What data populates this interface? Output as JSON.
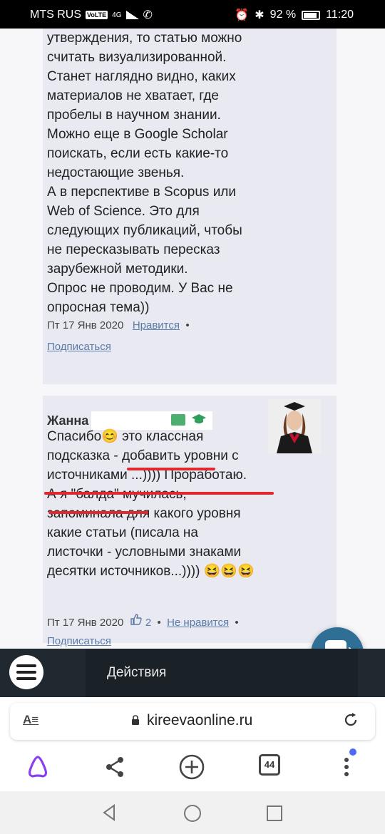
{
  "status_bar": {
    "carrier": "MTS RUS",
    "volte": "VoLTE",
    "network": "4G",
    "battery": "92 %",
    "time": "11:20"
  },
  "comment1": {
    "text": "утверждения, то статью можно\nсчитать визуализированной.\nСтанет наглядно видно, каких\nматериалов не хватает, где\nпробелы в научном знании.\nМожно еще в Google Scholar\nпоискать, если есть какие-то\nнедостающие звенья.\nА в перспективе в Scopus или\nWeb of Science. Это для\nследующих публикаций, чтобы\nне пересказывать пересказ\nзарубежной методики.\nОпрос не проводим. У Вас не\nопросная тема))",
    "date": "Пт 17 Янв 2020",
    "like_label": "Нравится",
    "subscribe_label": "Подписаться"
  },
  "comment2": {
    "author": "Жанна",
    "text_prefix": "Спасибо",
    "text": "это классная\nподсказка - добавить уровни с\nисточниками ...)))) Проработаю.\nА я \"балда\" мучилась,\nзапоминала для какого уровня\nкакие статьи (писала на\nлисточки - условными знаками\nдесятки источников...)))) ",
    "date": "Пт 17 Янв 2020",
    "likes": "2",
    "dislike_label": "Не нравится",
    "subscribe_label": "Подписаться"
  },
  "action_bar": {
    "label": "Действия"
  },
  "url_bar": {
    "url": "kireevaonline.ru",
    "reader_label": "A≡"
  },
  "browser_bar": {
    "tab_count": "44"
  },
  "colors": {
    "link": "#5a7ba8",
    "card": "#e8e9f1",
    "fab": "#2f6f96",
    "underline": "#e0292e"
  },
  "icons": [
    "menu-icon",
    "lock-icon",
    "reload-icon",
    "alice-icon",
    "share-icon",
    "new-tab-icon",
    "tabs-icon",
    "more-icon",
    "chat-icon",
    "back-icon",
    "home-icon",
    "recents-icon"
  ]
}
